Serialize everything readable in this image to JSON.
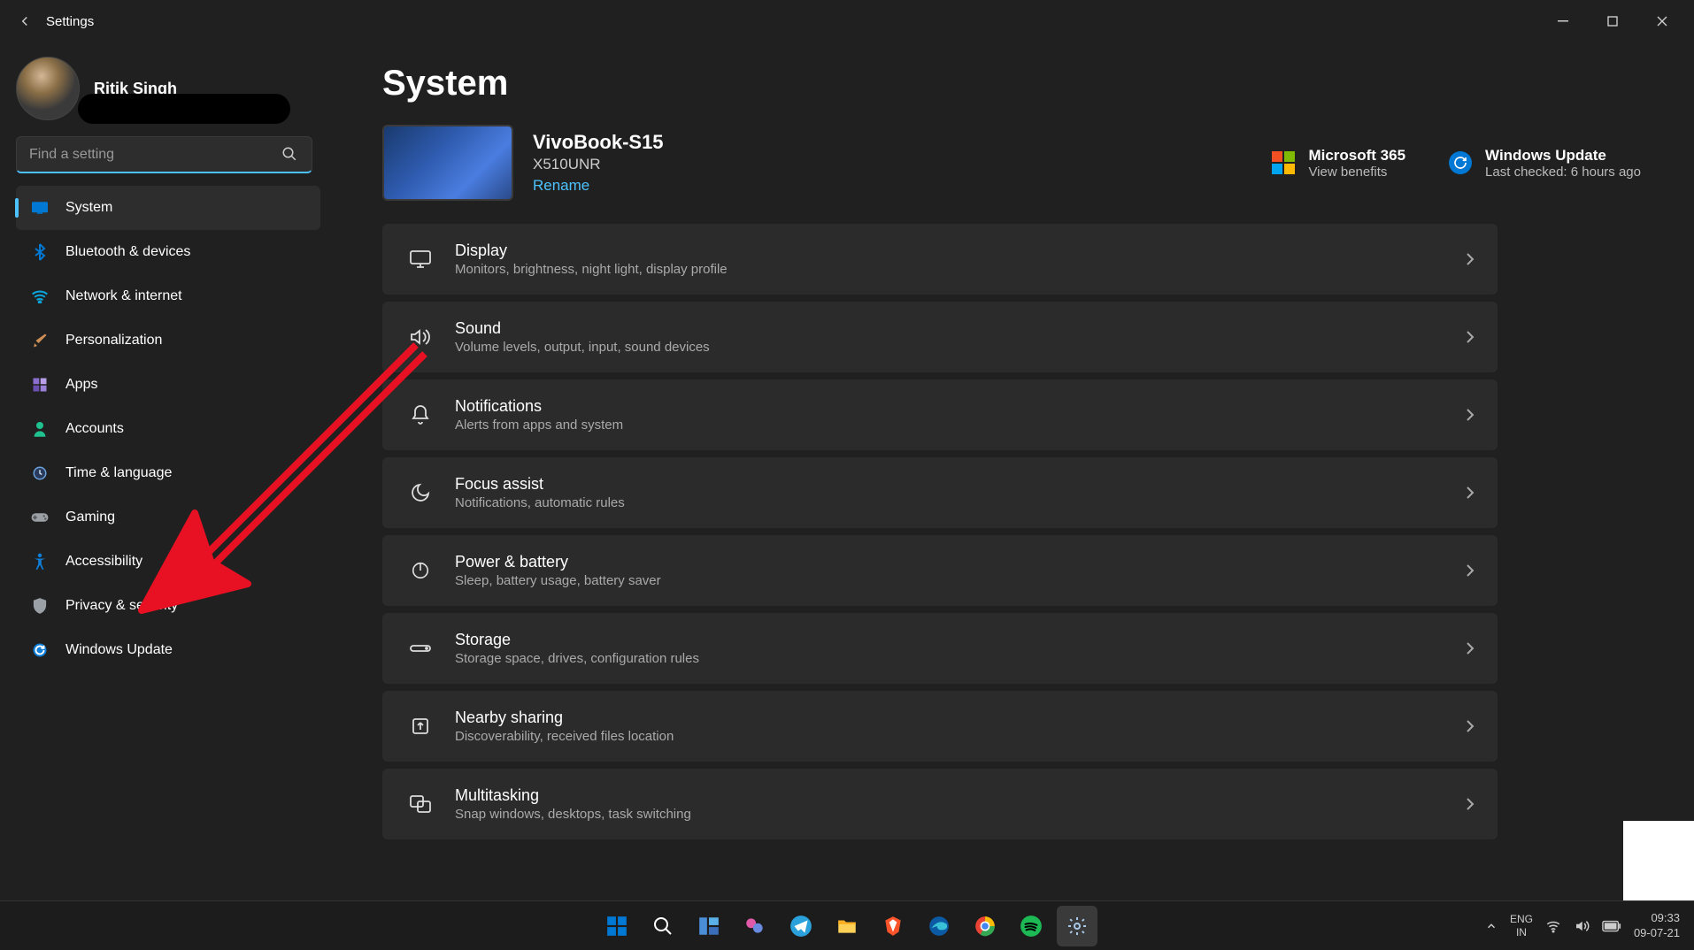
{
  "window": {
    "title": "Settings"
  },
  "user": {
    "name": "Ritik Singh"
  },
  "search": {
    "placeholder": "Find a setting"
  },
  "sidebar": {
    "items": [
      {
        "label": "System",
        "icon": "system",
        "color": "#0078d4",
        "active": true
      },
      {
        "label": "Bluetooth & devices",
        "icon": "bluetooth",
        "color": "#0078d4"
      },
      {
        "label": "Network & internet",
        "icon": "wifi",
        "color": "#0aa3da"
      },
      {
        "label": "Personalization",
        "icon": "brush",
        "color": "#cf8e55"
      },
      {
        "label": "Apps",
        "icon": "apps",
        "color": "#8a6fd1"
      },
      {
        "label": "Accounts",
        "icon": "person",
        "color": "#1fc28f"
      },
      {
        "label": "Time & language",
        "icon": "clock",
        "color": "#6aa2dd"
      },
      {
        "label": "Gaming",
        "icon": "gamepad",
        "color": "#9aa0a6"
      },
      {
        "label": "Accessibility",
        "icon": "accessibility",
        "color": "#0e7ed8"
      },
      {
        "label": "Privacy & security",
        "icon": "shield",
        "color": "#9aa0a6"
      },
      {
        "label": "Windows Update",
        "icon": "update",
        "color": "#0e7ed8"
      }
    ]
  },
  "page": {
    "title": "System",
    "device": {
      "name": "VivoBook-S15",
      "model": "X510UNR",
      "rename": "Rename"
    },
    "ms365": {
      "title": "Microsoft 365",
      "sub": "View benefits"
    },
    "winupdate": {
      "title": "Windows Update",
      "sub": "Last checked: 6 hours ago"
    },
    "cards": [
      {
        "key": "display",
        "icon": "display",
        "title": "Display",
        "sub": "Monitors, brightness, night light, display profile"
      },
      {
        "key": "sound",
        "icon": "sound",
        "title": "Sound",
        "sub": "Volume levels, output, input, sound devices"
      },
      {
        "key": "notifications",
        "icon": "bell",
        "title": "Notifications",
        "sub": "Alerts from apps and system"
      },
      {
        "key": "focus-assist",
        "icon": "moon",
        "title": "Focus assist",
        "sub": "Notifications, automatic rules"
      },
      {
        "key": "power",
        "icon": "power",
        "title": "Power & battery",
        "sub": "Sleep, battery usage, battery saver"
      },
      {
        "key": "storage",
        "icon": "storage",
        "title": "Storage",
        "sub": "Storage space, drives, configuration rules"
      },
      {
        "key": "nearby",
        "icon": "share",
        "title": "Nearby sharing",
        "sub": "Discoverability, received files location"
      },
      {
        "key": "multitask",
        "icon": "multitask",
        "title": "Multitasking",
        "sub": "Snap windows, desktops, task switching"
      }
    ]
  },
  "taskbar": {
    "lang": {
      "top": "ENG",
      "bottom": "IN"
    },
    "clock": {
      "time": "09:33",
      "date": "09-07-21"
    }
  }
}
